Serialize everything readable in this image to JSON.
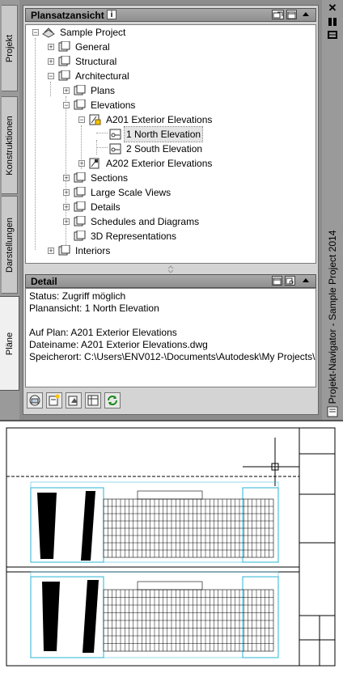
{
  "left_tabs": [
    "Projekt",
    "Konstruktionen",
    "Darstellungen",
    "Pläne"
  ],
  "sheet_set_view": {
    "title": "Plansatzansicht",
    "info_icon": "i",
    "tree": {
      "root": "Sample Project",
      "general": "General",
      "structural": "Structural",
      "architectural": "Architectural",
      "plans": "Plans",
      "elevations": "Elevations",
      "a201": "A201 Exterior Elevations",
      "north": "1 North Elevation",
      "south": "2 South Elevation",
      "a202": "A202 Exterior Elevations",
      "sections": "Sections",
      "large_scale": "Large Scale Views",
      "details": "Details",
      "schedules": "Schedules and Diagrams",
      "representations": "3D Representations",
      "interiors": "Interiors"
    }
  },
  "detail": {
    "title": "Detail",
    "status": "Status: Zugriff möglich",
    "planansicht": "Planansicht: 1 North Elevation",
    "auf_plan": "Auf Plan: A201 Exterior Elevations",
    "dateiname": "Dateiname: A201 Exterior Elevations.dwg",
    "speicherort": "Speicherort: C:\\Users\\ENV012-\\Documents\\Autodesk\\My Projects\\"
  },
  "palette_title": "Projekt-Navigator - Sample Project 2014",
  "bottom_tools": [
    "open-drawing-icon",
    "new-sheet-icon",
    "publish-icon",
    "sheet-list-icon",
    "refresh-icon"
  ],
  "colors": {
    "panel_bg": "#d4d4d4",
    "header_bg": "#9a9a9a",
    "drawing_blue": "#29b6d6"
  }
}
